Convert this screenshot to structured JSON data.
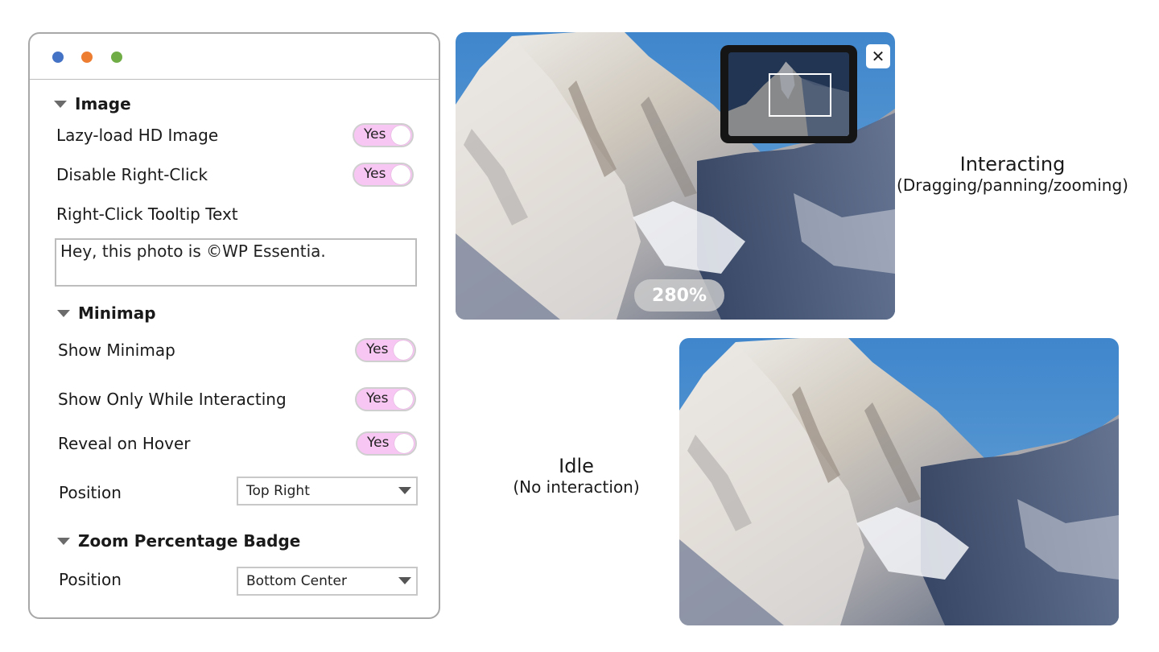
{
  "window": {
    "traffic_lights": [
      "blue",
      "orange",
      "green"
    ],
    "colors": {
      "blue": "#4472c4",
      "orange": "#ed7d31",
      "green": "#70ad47"
    }
  },
  "settings": {
    "image_section": {
      "title": "Image",
      "lazy_load": {
        "label": "Lazy-load HD Image",
        "value": "Yes"
      },
      "disable_right_click": {
        "label": "Disable Right-Click",
        "value": "Yes"
      },
      "tooltip_text": {
        "label": "Right-Click Tooltip Text",
        "value": "Hey, this photo is ©WP Essentia."
      }
    },
    "minimap_section": {
      "title": "Minimap",
      "show_minimap": {
        "label": "Show Minimap",
        "value": "Yes"
      },
      "show_only_while_interacting": {
        "label": "Show Only While Interacting",
        "value": "Yes"
      },
      "reveal_on_hover": {
        "label": "Reveal on Hover",
        "value": "Yes"
      },
      "position": {
        "label": "Position",
        "value": "Top Right"
      }
    },
    "zoom_badge_section": {
      "title": "Zoom Percentage Badge",
      "position": {
        "label": "Position",
        "value": "Bottom Center"
      }
    },
    "toggle_color": "#f7c6f2"
  },
  "preview_interacting": {
    "zoom_badge": "280%",
    "close_icon": "close-icon",
    "caption": "Interacting",
    "caption_sub": "(Dragging/panning/zooming)"
  },
  "preview_idle": {
    "caption": "Idle",
    "caption_sub": "(No interaction)"
  }
}
